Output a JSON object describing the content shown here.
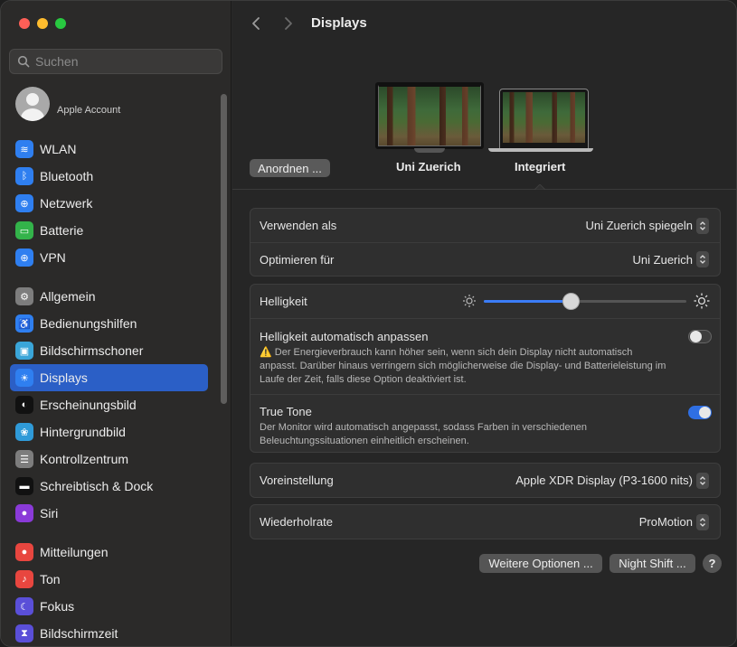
{
  "window": {
    "title": "Displays"
  },
  "sidebar": {
    "search_placeholder": "Suchen",
    "account_label": "Apple Account",
    "groups": [
      [
        {
          "label": "WLAN",
          "icon": "wifi-icon",
          "color": "#2f7ff0"
        },
        {
          "label": "Bluetooth",
          "icon": "bluetooth-icon",
          "color": "#2f7ff0"
        },
        {
          "label": "Netzwerk",
          "icon": "globe-icon",
          "color": "#2f7ff0"
        },
        {
          "label": "Batterie",
          "icon": "battery-icon",
          "color": "#33b34a"
        },
        {
          "label": "VPN",
          "icon": "vpn-icon",
          "color": "#2f7ff0"
        }
      ],
      [
        {
          "label": "Allgemein",
          "icon": "gear-icon",
          "color": "#7d7d7d"
        },
        {
          "label": "Bedienungshilfen",
          "icon": "accessibility-icon",
          "color": "#2f7ff0"
        },
        {
          "label": "Bildschirmschoner",
          "icon": "screensaver-icon",
          "color": "#3aa5d8"
        },
        {
          "label": "Displays",
          "icon": "brightness-icon",
          "color": "#2f7ff0",
          "active": true
        },
        {
          "label": "Erscheinungsbild",
          "icon": "appearance-icon",
          "color": "#111111"
        },
        {
          "label": "Hintergrundbild",
          "icon": "wallpaper-icon",
          "color": "#2f9ad8"
        },
        {
          "label": "Kontrollzentrum",
          "icon": "control-center-icon",
          "color": "#7d7d7d"
        },
        {
          "label": "Schreibtisch & Dock",
          "icon": "dock-icon",
          "color": "#111111"
        },
        {
          "label": "Siri",
          "icon": "siri-icon",
          "color": "#8a3ad8"
        }
      ],
      [
        {
          "label": "Mitteilungen",
          "icon": "bell-icon",
          "color": "#e8463f"
        },
        {
          "label": "Ton",
          "icon": "speaker-icon",
          "color": "#e8463f"
        },
        {
          "label": "Fokus",
          "icon": "moon-icon",
          "color": "#5a4fd8"
        },
        {
          "label": "Bildschirmzeit",
          "icon": "hourglass-icon",
          "color": "#5a4fd8"
        }
      ]
    ]
  },
  "displays": {
    "arrange_button": "Anordnen ...",
    "items": [
      {
        "label": "Uni Zuerich"
      },
      {
        "label": "Integriert",
        "selected": true
      }
    ]
  },
  "settings": {
    "use_as": {
      "label": "Verwenden als",
      "value": "Uni Zuerich spiegeln"
    },
    "optimize_for": {
      "label": "Optimieren für",
      "value": "Uni Zuerich"
    },
    "brightness": {
      "label": "Helligkeit",
      "level": 0.43
    },
    "auto_brightness": {
      "label": "Helligkeit automatisch anpassen",
      "warning": "Der Energieverbrauch kann höher sein, wenn sich dein Display nicht automatisch anpasst. Darüber hinaus verringern sich möglicherweise die Display- und Batterie­leistung im Laufe der Zeit, falls diese Option deaktiviert ist.",
      "enabled": false
    },
    "true_tone": {
      "label": "True Tone",
      "description": "Der Monitor wird automatisch angepasst, sodass Farben in verschiedenen Beleuchtungssituationen einheitlich erscheinen.",
      "enabled": true
    },
    "preset": {
      "label": "Voreinstellung",
      "value": "Apple XDR Display (P3-1600 nits)"
    },
    "refresh_rate": {
      "label": "Wiederholrate",
      "value": "ProMotion"
    }
  },
  "footer": {
    "more_options": "Weitere Optionen ...",
    "night_shift": "Night Shift ...",
    "help": "?"
  }
}
